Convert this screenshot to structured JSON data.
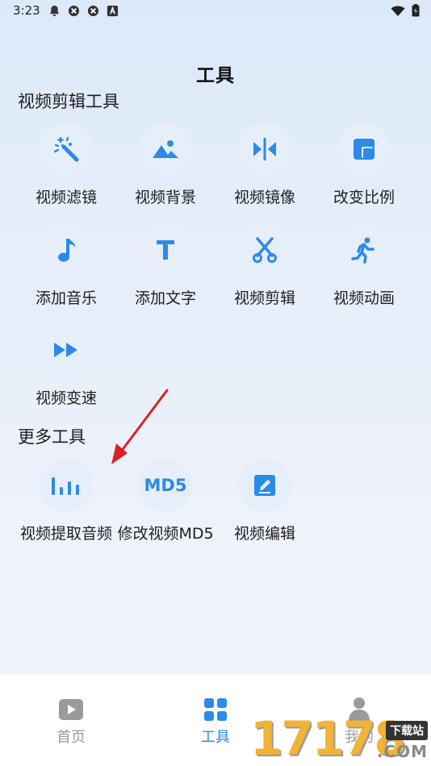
{
  "status_bar": {
    "time": "3:23"
  },
  "page": {
    "title": "工具"
  },
  "sections": {
    "video_editing": {
      "title": "视频剪辑工具",
      "tools": [
        {
          "label": "视频滤镜",
          "icon": "magic-wand-icon"
        },
        {
          "label": "视频背景",
          "icon": "image-icon"
        },
        {
          "label": "视频镜像",
          "icon": "mirror-icon"
        },
        {
          "label": "改变比例",
          "icon": "aspect-ratio-icon"
        },
        {
          "label": "添加音乐",
          "icon": "music-note-icon"
        },
        {
          "label": "添加文字",
          "icon": "text-icon"
        },
        {
          "label": "视频剪辑",
          "icon": "scissors-icon"
        },
        {
          "label": "视频动画",
          "icon": "running-person-icon"
        },
        {
          "label": "视频变速",
          "icon": "fast-forward-icon"
        }
      ]
    },
    "more_tools": {
      "title": "更多工具",
      "tools": [
        {
          "label": "视频提取音频",
          "icon": "audio-bars-icon"
        },
        {
          "label": "修改视频MD5",
          "icon": "md5-icon",
          "icon_text": "MD5"
        },
        {
          "label": "视频编辑",
          "icon": "edit-icon"
        }
      ]
    }
  },
  "bottom_nav": {
    "items": [
      {
        "label": "首页",
        "icon": "play-icon",
        "active": false
      },
      {
        "label": "工具",
        "icon": "grid-icon",
        "active": true
      },
      {
        "label": "我的",
        "icon": "person-icon",
        "active": false
      }
    ]
  },
  "watermark": {
    "digits": "17178",
    "tag": "下载站",
    "domain": ".COM"
  },
  "colors": {
    "accent": "#2c8ae8",
    "inactive": "#9a9a9a",
    "icon_bg": "#e6eef9"
  }
}
